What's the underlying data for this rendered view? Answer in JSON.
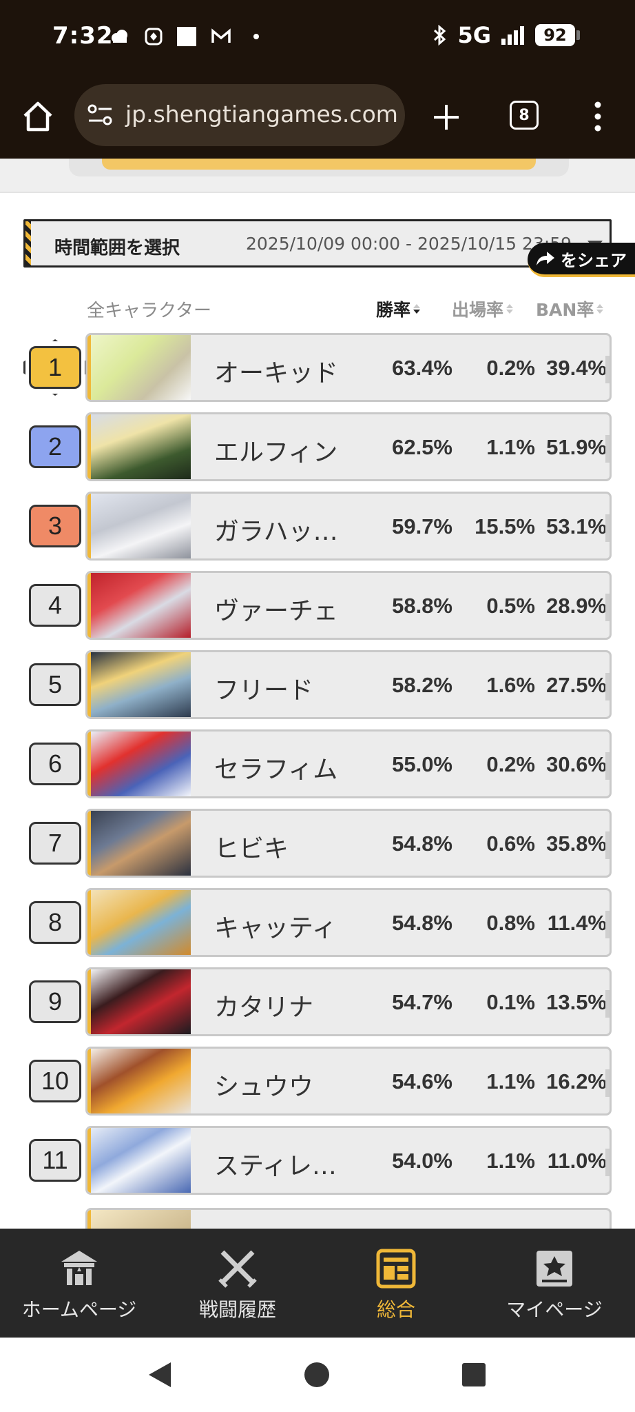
{
  "status_bar": {
    "time": "7:32",
    "network": "5G",
    "battery": "92",
    "icons": [
      "cloud-icon",
      "app-icon",
      "square-icon",
      "gmail-icon",
      "dot-icon",
      "bluetooth-icon",
      "signal-icon",
      "battery-icon"
    ]
  },
  "browser": {
    "url": "jp.shengtiangames.com",
    "tab_count": "8",
    "icons": [
      "home-icon",
      "site-settings-icon",
      "new-tab-icon",
      "tab-switcher-icon",
      "more-menu-icon"
    ]
  },
  "filter": {
    "label": "時間範囲を選択",
    "range": "2025/10/09 00:00 - 2025/10/15 23:59",
    "share_label": "をシェア"
  },
  "table": {
    "all_label": "全キャラクター",
    "headers": {
      "win": "勝率",
      "pick": "出場率",
      "ban": "BAN率"
    },
    "rows": [
      {
        "rank": "1",
        "name": "オーキッド",
        "win": "63.4%",
        "pick": "0.2%",
        "ban": "39.4%"
      },
      {
        "rank": "2",
        "name": "エルフィン",
        "win": "62.5%",
        "pick": "1.1%",
        "ban": "51.9%"
      },
      {
        "rank": "3",
        "name": "ガラハッ…",
        "win": "59.7%",
        "pick": "15.5%",
        "ban": "53.1%"
      },
      {
        "rank": "4",
        "name": "ヴァーチェ",
        "win": "58.8%",
        "pick": "0.5%",
        "ban": "28.9%"
      },
      {
        "rank": "5",
        "name": "フリード",
        "win": "58.2%",
        "pick": "1.6%",
        "ban": "27.5%"
      },
      {
        "rank": "6",
        "name": "セラフィム",
        "win": "55.0%",
        "pick": "0.2%",
        "ban": "30.6%"
      },
      {
        "rank": "7",
        "name": "ヒビキ",
        "win": "54.8%",
        "pick": "0.6%",
        "ban": "35.8%"
      },
      {
        "rank": "8",
        "name": "キャッティ",
        "win": "54.8%",
        "pick": "0.8%",
        "ban": "11.4%"
      },
      {
        "rank": "9",
        "name": "カタリナ",
        "win": "54.7%",
        "pick": "0.1%",
        "ban": "13.5%"
      },
      {
        "rank": "10",
        "name": "シュウウ",
        "win": "54.6%",
        "pick": "1.1%",
        "ban": "16.2%"
      },
      {
        "rank": "11",
        "name": "スティレ…",
        "win": "54.0%",
        "pick": "1.1%",
        "ban": "11.0%"
      }
    ]
  },
  "bottom_nav": {
    "items": [
      {
        "label": "ホームページ",
        "icon": "castle-icon"
      },
      {
        "label": "戦闘履歴",
        "icon": "crossed-swords-icon"
      },
      {
        "label": "総合",
        "icon": "dashboard-icon"
      },
      {
        "label": "マイページ",
        "icon": "profile-card-icon"
      }
    ],
    "active_index": 2
  },
  "colors": {
    "accent": "#f0b838",
    "rank_1": "#f3c140",
    "rank_2": "#8da4ef",
    "rank_3": "#ef8a66",
    "top_bar": "#1d130b",
    "nav_bg": "#282828"
  }
}
